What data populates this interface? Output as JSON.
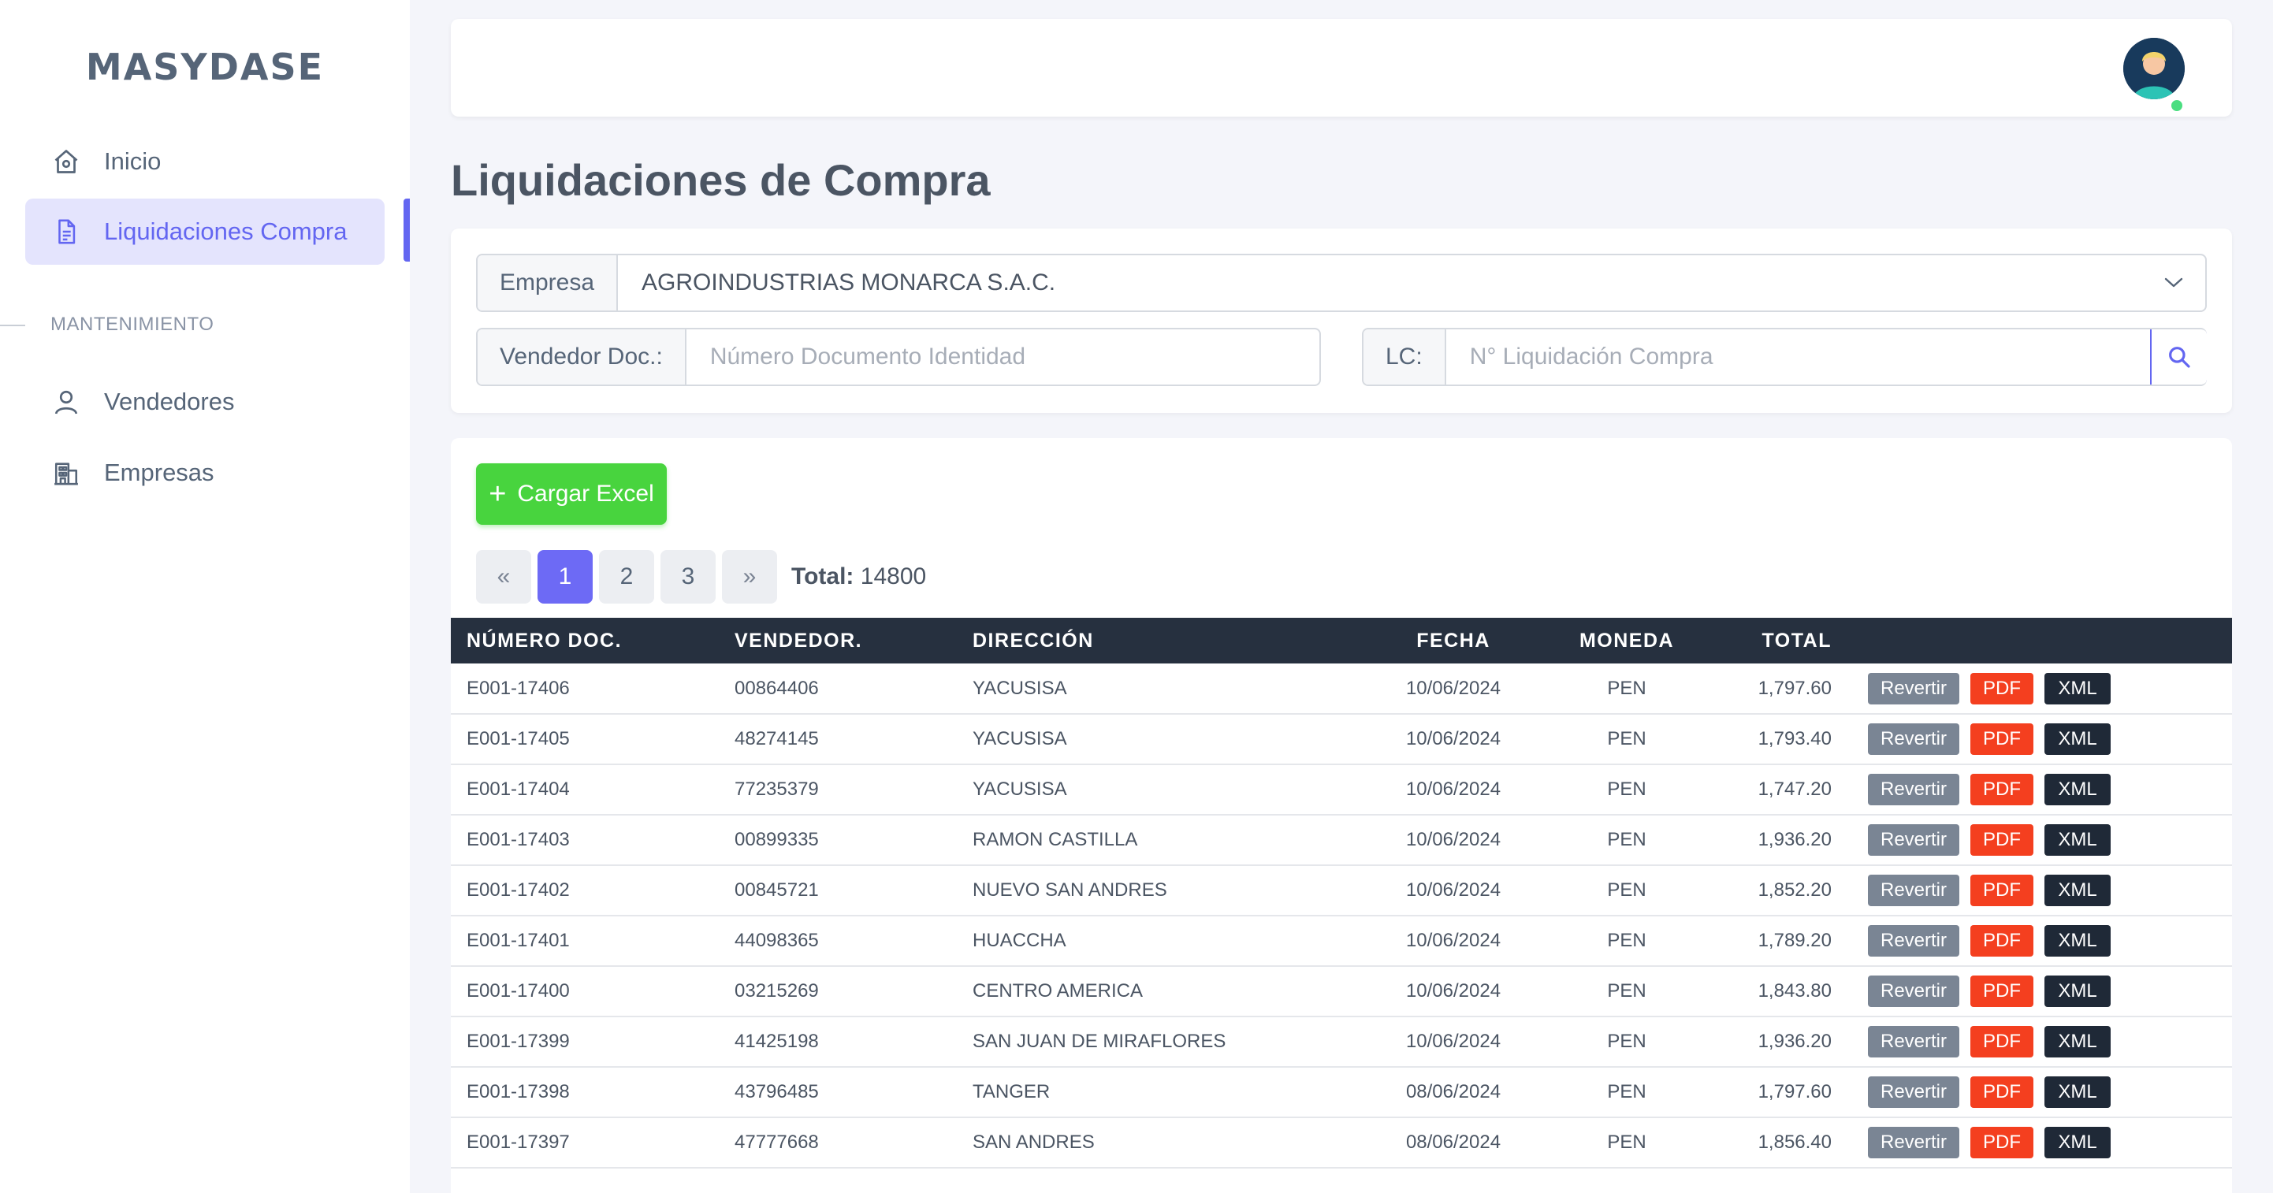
{
  "app": {
    "brand": "MASYDASE"
  },
  "sidebar": {
    "items": [
      {
        "label": "Inicio",
        "icon": "home-icon"
      },
      {
        "label": "Liquidaciones Compra",
        "icon": "document-icon",
        "active": true
      }
    ],
    "section_label": "MANTENIMIENTO",
    "section_items": [
      {
        "label": "Vendedores",
        "icon": "user-icon"
      },
      {
        "label": "Empresas",
        "icon": "building-icon"
      }
    ]
  },
  "page": {
    "title": "Liquidaciones de Compra"
  },
  "filters": {
    "empresa_label": "Empresa",
    "empresa_value": "AGROINDUSTRIAS MONARCA S.A.C.",
    "vendedor_label": "Vendedor Doc.:",
    "vendedor_placeholder": "Número Documento Identidad",
    "lc_label": "LC:",
    "lc_placeholder": "N° Liquidación Compra"
  },
  "actions": {
    "upload_label": "Cargar Excel"
  },
  "pagination": {
    "prev": "«",
    "pages": [
      "1",
      "2",
      "3"
    ],
    "next": "»",
    "current": "1",
    "total_label": "Total:",
    "total_value": "14800"
  },
  "table": {
    "headers": [
      "NÚMERO DOC.",
      "VENDEDOR.",
      "DIRECCIÓN",
      "FECHA",
      "MONEDA",
      "TOTAL"
    ],
    "action_labels": {
      "revert": "Revertir",
      "pdf": "PDF",
      "xml": "XML"
    },
    "rows": [
      {
        "doc": "E001-17406",
        "vendedor": "00864406",
        "direccion": "YACUSISA",
        "fecha": "10/06/2024",
        "moneda": "PEN",
        "total": "1,797.60"
      },
      {
        "doc": "E001-17405",
        "vendedor": "48274145",
        "direccion": "YACUSISA",
        "fecha": "10/06/2024",
        "moneda": "PEN",
        "total": "1,793.40"
      },
      {
        "doc": "E001-17404",
        "vendedor": "77235379",
        "direccion": "YACUSISA",
        "fecha": "10/06/2024",
        "moneda": "PEN",
        "total": "1,747.20"
      },
      {
        "doc": "E001-17403",
        "vendedor": "00899335",
        "direccion": "RAMON CASTILLA",
        "fecha": "10/06/2024",
        "moneda": "PEN",
        "total": "1,936.20"
      },
      {
        "doc": "E001-17402",
        "vendedor": "00845721",
        "direccion": "NUEVO SAN ANDRES",
        "fecha": "10/06/2024",
        "moneda": "PEN",
        "total": "1,852.20"
      },
      {
        "doc": "E001-17401",
        "vendedor": "44098365",
        "direccion": "HUACCHA",
        "fecha": "10/06/2024",
        "moneda": "PEN",
        "total": "1,789.20"
      },
      {
        "doc": "E001-17400",
        "vendedor": "03215269",
        "direccion": "CENTRO AMERICA",
        "fecha": "10/06/2024",
        "moneda": "PEN",
        "total": "1,843.80"
      },
      {
        "doc": "E001-17399",
        "vendedor": "41425198",
        "direccion": "SAN JUAN DE MIRAFLORES",
        "fecha": "10/06/2024",
        "moneda": "PEN",
        "total": "1,936.20"
      },
      {
        "doc": "E001-17398",
        "vendedor": "43796485",
        "direccion": "TANGER",
        "fecha": "08/06/2024",
        "moneda": "PEN",
        "total": "1,797.60"
      },
      {
        "doc": "E001-17397",
        "vendedor": "47777668",
        "direccion": "SAN ANDRES",
        "fecha": "08/06/2024",
        "moneda": "PEN",
        "total": "1,856.40"
      }
    ]
  },
  "colors": {
    "accent": "#6366f1",
    "success": "#48d43e",
    "danger": "#f43f1f",
    "dark": "#1f2937",
    "table_header": "#26303f"
  }
}
